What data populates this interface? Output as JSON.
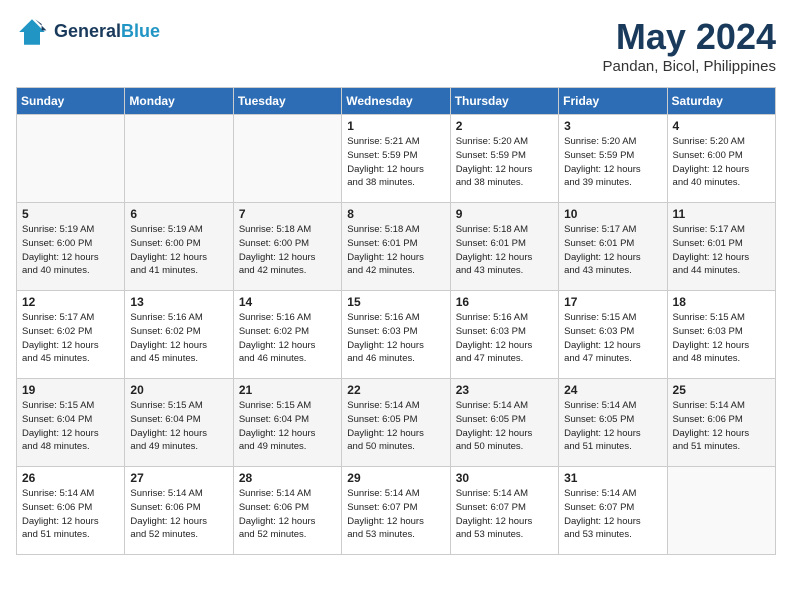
{
  "header": {
    "logo_line1": "General",
    "logo_line2": "Blue",
    "month": "May 2024",
    "location": "Pandan, Bicol, Philippines"
  },
  "weekdays": [
    "Sunday",
    "Monday",
    "Tuesday",
    "Wednesday",
    "Thursday",
    "Friday",
    "Saturday"
  ],
  "weeks": [
    [
      {
        "day": "",
        "info": ""
      },
      {
        "day": "",
        "info": ""
      },
      {
        "day": "",
        "info": ""
      },
      {
        "day": "1",
        "info": "Sunrise: 5:21 AM\nSunset: 5:59 PM\nDaylight: 12 hours\nand 38 minutes."
      },
      {
        "day": "2",
        "info": "Sunrise: 5:20 AM\nSunset: 5:59 PM\nDaylight: 12 hours\nand 38 minutes."
      },
      {
        "day": "3",
        "info": "Sunrise: 5:20 AM\nSunset: 5:59 PM\nDaylight: 12 hours\nand 39 minutes."
      },
      {
        "day": "4",
        "info": "Sunrise: 5:20 AM\nSunset: 6:00 PM\nDaylight: 12 hours\nand 40 minutes."
      }
    ],
    [
      {
        "day": "5",
        "info": "Sunrise: 5:19 AM\nSunset: 6:00 PM\nDaylight: 12 hours\nand 40 minutes."
      },
      {
        "day": "6",
        "info": "Sunrise: 5:19 AM\nSunset: 6:00 PM\nDaylight: 12 hours\nand 41 minutes."
      },
      {
        "day": "7",
        "info": "Sunrise: 5:18 AM\nSunset: 6:00 PM\nDaylight: 12 hours\nand 42 minutes."
      },
      {
        "day": "8",
        "info": "Sunrise: 5:18 AM\nSunset: 6:01 PM\nDaylight: 12 hours\nand 42 minutes."
      },
      {
        "day": "9",
        "info": "Sunrise: 5:18 AM\nSunset: 6:01 PM\nDaylight: 12 hours\nand 43 minutes."
      },
      {
        "day": "10",
        "info": "Sunrise: 5:17 AM\nSunset: 6:01 PM\nDaylight: 12 hours\nand 43 minutes."
      },
      {
        "day": "11",
        "info": "Sunrise: 5:17 AM\nSunset: 6:01 PM\nDaylight: 12 hours\nand 44 minutes."
      }
    ],
    [
      {
        "day": "12",
        "info": "Sunrise: 5:17 AM\nSunset: 6:02 PM\nDaylight: 12 hours\nand 45 minutes."
      },
      {
        "day": "13",
        "info": "Sunrise: 5:16 AM\nSunset: 6:02 PM\nDaylight: 12 hours\nand 45 minutes."
      },
      {
        "day": "14",
        "info": "Sunrise: 5:16 AM\nSunset: 6:02 PM\nDaylight: 12 hours\nand 46 minutes."
      },
      {
        "day": "15",
        "info": "Sunrise: 5:16 AM\nSunset: 6:03 PM\nDaylight: 12 hours\nand 46 minutes."
      },
      {
        "day": "16",
        "info": "Sunrise: 5:16 AM\nSunset: 6:03 PM\nDaylight: 12 hours\nand 47 minutes."
      },
      {
        "day": "17",
        "info": "Sunrise: 5:15 AM\nSunset: 6:03 PM\nDaylight: 12 hours\nand 47 minutes."
      },
      {
        "day": "18",
        "info": "Sunrise: 5:15 AM\nSunset: 6:03 PM\nDaylight: 12 hours\nand 48 minutes."
      }
    ],
    [
      {
        "day": "19",
        "info": "Sunrise: 5:15 AM\nSunset: 6:04 PM\nDaylight: 12 hours\nand 48 minutes."
      },
      {
        "day": "20",
        "info": "Sunrise: 5:15 AM\nSunset: 6:04 PM\nDaylight: 12 hours\nand 49 minutes."
      },
      {
        "day": "21",
        "info": "Sunrise: 5:15 AM\nSunset: 6:04 PM\nDaylight: 12 hours\nand 49 minutes."
      },
      {
        "day": "22",
        "info": "Sunrise: 5:14 AM\nSunset: 6:05 PM\nDaylight: 12 hours\nand 50 minutes."
      },
      {
        "day": "23",
        "info": "Sunrise: 5:14 AM\nSunset: 6:05 PM\nDaylight: 12 hours\nand 50 minutes."
      },
      {
        "day": "24",
        "info": "Sunrise: 5:14 AM\nSunset: 6:05 PM\nDaylight: 12 hours\nand 51 minutes."
      },
      {
        "day": "25",
        "info": "Sunrise: 5:14 AM\nSunset: 6:06 PM\nDaylight: 12 hours\nand 51 minutes."
      }
    ],
    [
      {
        "day": "26",
        "info": "Sunrise: 5:14 AM\nSunset: 6:06 PM\nDaylight: 12 hours\nand 51 minutes."
      },
      {
        "day": "27",
        "info": "Sunrise: 5:14 AM\nSunset: 6:06 PM\nDaylight: 12 hours\nand 52 minutes."
      },
      {
        "day": "28",
        "info": "Sunrise: 5:14 AM\nSunset: 6:06 PM\nDaylight: 12 hours\nand 52 minutes."
      },
      {
        "day": "29",
        "info": "Sunrise: 5:14 AM\nSunset: 6:07 PM\nDaylight: 12 hours\nand 53 minutes."
      },
      {
        "day": "30",
        "info": "Sunrise: 5:14 AM\nSunset: 6:07 PM\nDaylight: 12 hours\nand 53 minutes."
      },
      {
        "day": "31",
        "info": "Sunrise: 5:14 AM\nSunset: 6:07 PM\nDaylight: 12 hours\nand 53 minutes."
      },
      {
        "day": "",
        "info": ""
      }
    ]
  ]
}
